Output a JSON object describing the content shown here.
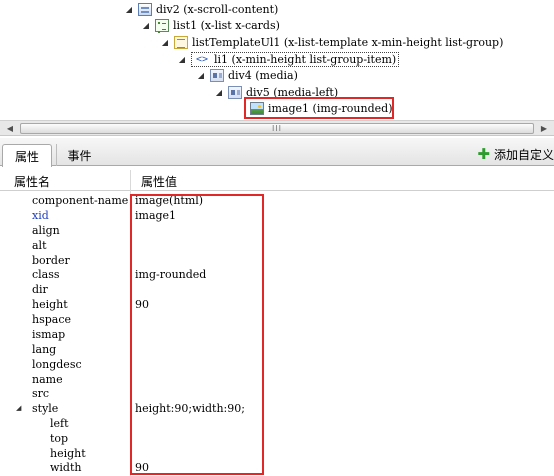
{
  "tree": {
    "nodes": [
      {
        "id": "div2",
        "label": "div2 (x-scroll-content)",
        "icon": "div-icon"
      },
      {
        "id": "list1",
        "label": "list1 (x-list x-cards)",
        "icon": "list-icon"
      },
      {
        "id": "listTemplateUl1",
        "label": "listTemplateUl1 (x-list-template x-min-height list-group)",
        "icon": "ul-icon"
      },
      {
        "id": "li1",
        "label": "li1 (x-min-height list-group-item)",
        "icon": "code-icon"
      },
      {
        "id": "div4",
        "label": "div4 (media)",
        "icon": "media-icon"
      },
      {
        "id": "div5",
        "label": "div5 (media-left)",
        "icon": "media-icon"
      },
      {
        "id": "image1",
        "label": "image1 (img-rounded)",
        "icon": "image-icon"
      }
    ],
    "code_glyph": "<>"
  },
  "scrollbar": {
    "left_arrow": "◀",
    "right_arrow": "▶",
    "grip": "III"
  },
  "tabs": [
    {
      "label": "属性",
      "active": true
    },
    {
      "label": "事件",
      "active": false
    }
  ],
  "add_button": {
    "label": "添加自定义",
    "icon": "plus-icon",
    "plus_glyph": "✚"
  },
  "grid": {
    "header_name": "属性名",
    "header_value": "属性值",
    "expand_glyph": "◢",
    "rows": [
      {
        "name": "component-name",
        "value": "image(html)"
      },
      {
        "name": "xid",
        "value": "image1"
      },
      {
        "name": "align",
        "value": ""
      },
      {
        "name": "alt",
        "value": ""
      },
      {
        "name": "border",
        "value": ""
      },
      {
        "name": "class",
        "value": "img-rounded"
      },
      {
        "name": "dir",
        "value": ""
      },
      {
        "name": "height",
        "value": "90"
      },
      {
        "name": "hspace",
        "value": ""
      },
      {
        "name": "ismap",
        "value": ""
      },
      {
        "name": "lang",
        "value": ""
      },
      {
        "name": "longdesc",
        "value": ""
      },
      {
        "name": "name",
        "value": ""
      },
      {
        "name": "src",
        "value": ""
      },
      {
        "name": "style",
        "value": "height:90;width:90;"
      },
      {
        "name": "left",
        "value": ""
      },
      {
        "name": "top",
        "value": ""
      },
      {
        "name": "height",
        "value": ""
      },
      {
        "name": "width",
        "value": "90"
      }
    ]
  },
  "colors": {
    "highlight_border": "#e02828",
    "xid_label": "#1f3fbf",
    "add_icon": "#2e9b2e"
  }
}
